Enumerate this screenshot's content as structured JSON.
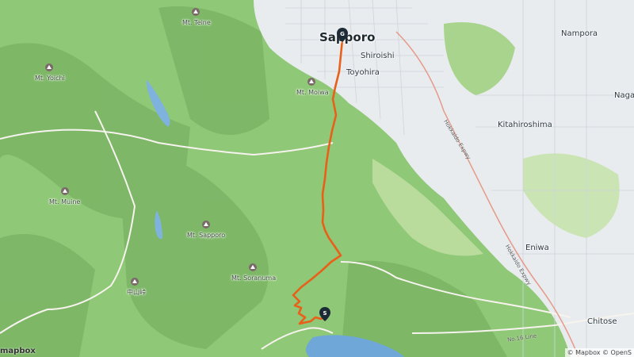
{
  "map": {
    "cities": {
      "sapporo": "Sapporo",
      "shiroishi": "Shiroishi",
      "toyohira": "Toyohira",
      "kitahiroshima": "Kitahiroshima",
      "nampora": "Nampora",
      "naga": "Naga",
      "eniwa": "Eniwa",
      "chitose": "Chitose"
    },
    "mountains": {
      "teine": "Mt. Teine",
      "yoichi": "Mt. Yoichi",
      "moiwa": "Mt. Moiwa",
      "muine": "Mt. Muine",
      "sapporo": "Mt. Sapporo",
      "soranuma": "Mt. Soranuma",
      "nakayama": "中山峠"
    },
    "roads": {
      "expressway": "Hokkaido Expwy",
      "route453": "No.16 Line"
    },
    "markers": {
      "finish": "G",
      "start": "S"
    },
    "logo": "mapbox",
    "attribution": "© Mapbox © OpenS"
  },
  "colors": {
    "route": "#e8601a",
    "forest": "#8cc56e",
    "urban": "#e7ebee",
    "water": "#6ca4d6",
    "marker": "#1d2b36"
  }
}
